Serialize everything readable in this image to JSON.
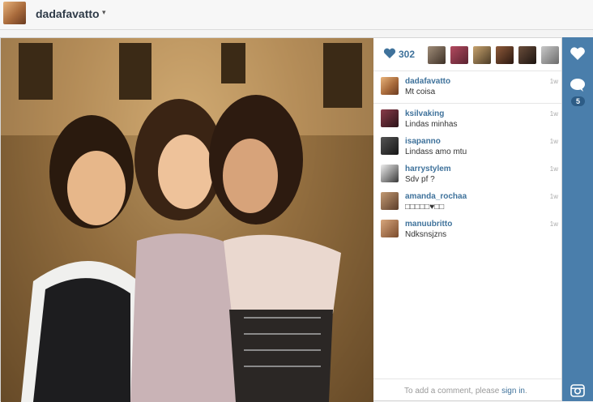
{
  "header": {
    "username": "dadafavatto",
    "caret": "▾"
  },
  "photo": {
    "description_icon": "photo"
  },
  "likes": {
    "count": "302"
  },
  "caption": {
    "user": "dadafavatto",
    "text": "Mt coisa",
    "time": "1w"
  },
  "comments": [
    {
      "user": "ksilvaking",
      "text": "Lindas minhas",
      "time": "1w"
    },
    {
      "user": "isapanno",
      "text": "Lindass amo mtu",
      "time": "1w"
    },
    {
      "user": "harrystylem",
      "text": "Sdv pf ?",
      "time": "1w"
    },
    {
      "user": "amanda_rochaa",
      "text": "□□□□□♥□□",
      "time": "1w"
    },
    {
      "user": "manuubritto",
      "text": "Ndksnsjzns",
      "time": "1w"
    }
  ],
  "add_comment": {
    "prefix": "To add a comment, please ",
    "link": "sign in",
    "suffix": "."
  },
  "rail": {
    "comment_count": "5"
  },
  "colors": {
    "rail": "#4a7eab",
    "link": "#3f729b",
    "badge": "#2d5c86"
  }
}
